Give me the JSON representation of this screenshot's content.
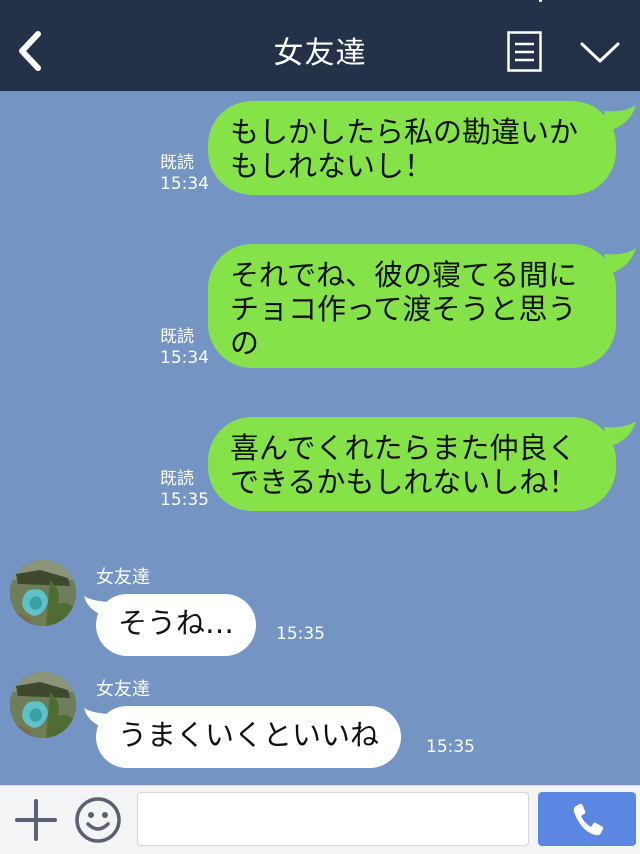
{
  "header": {
    "title": "女友達",
    "back_icon": "chevron-left-icon",
    "menu_icon": "menu-list-icon",
    "expand_icon": "chevron-down-icon"
  },
  "colors": {
    "header_bg": "#243149",
    "chat_bg": "#7494c4",
    "outgoing_bubble": "#85e249",
    "incoming_bubble": "#ffffff",
    "send_button": "#5b87e3"
  },
  "messages": [
    {
      "direction": "out",
      "lines": [
        "もしかしたら私の勘違いか",
        "もしれないし！"
      ],
      "read_label": "既読",
      "time": "15:34"
    },
    {
      "direction": "out",
      "lines": [
        "それでね、彼の寝てる間に",
        "チョコ作って渡そうと思う",
        "の"
      ],
      "read_label": "既読",
      "time": "15:34"
    },
    {
      "direction": "out",
      "lines": [
        "喜んでくれたらまた仲良く",
        "できるかもしれないしね！"
      ],
      "read_label": "既読",
      "time": "15:35"
    },
    {
      "direction": "in",
      "sender": "女友達",
      "text": "そうね…",
      "time": "15:35"
    },
    {
      "direction": "in",
      "sender": "女友達",
      "text": "うまくいくといいね",
      "time": "15:35"
    }
  ],
  "footer": {
    "plus_icon": "plus-icon",
    "emoji_icon": "smiley-icon",
    "input_value": "",
    "input_placeholder": "",
    "call_icon": "phone-icon"
  }
}
